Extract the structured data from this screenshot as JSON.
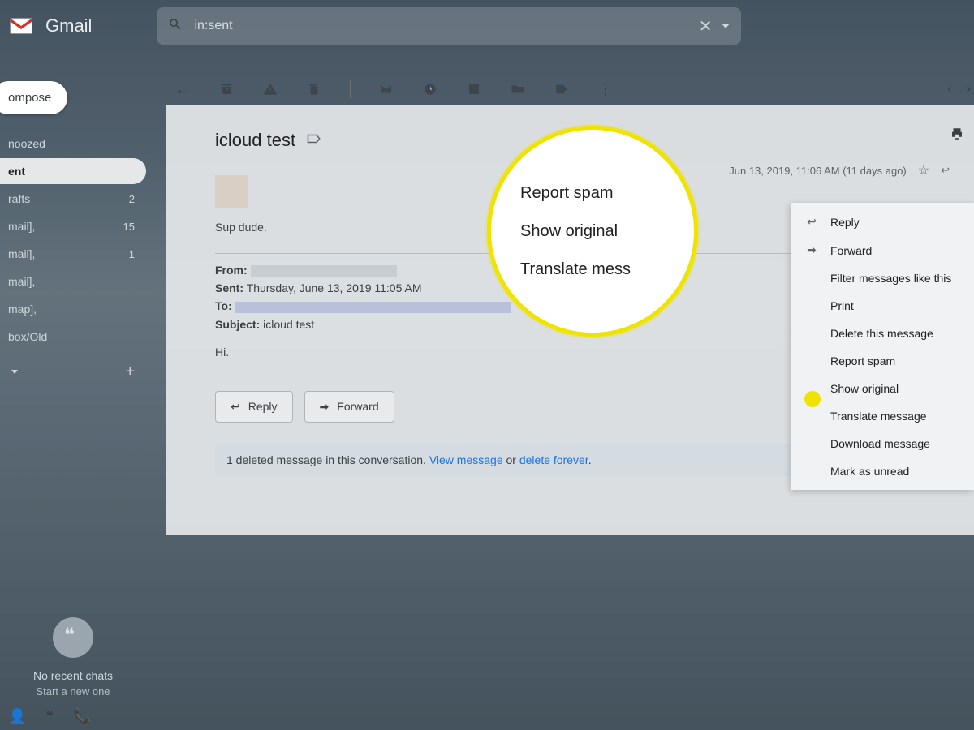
{
  "header": {
    "brand": "Gmail",
    "search_value": "in:sent"
  },
  "compose_label": "ompose",
  "nav": [
    {
      "label": "noozed",
      "count": ""
    },
    {
      "label": "ent",
      "count": ""
    },
    {
      "label": "rafts",
      "count": "2"
    },
    {
      "label": "mail],",
      "count": "15"
    },
    {
      "label": "mail],",
      "count": "1"
    },
    {
      "label": "mail],",
      "count": ""
    },
    {
      "label": "map],",
      "count": ""
    },
    {
      "label": "box/Old",
      "count": ""
    }
  ],
  "hangouts": {
    "line1": "No recent chats",
    "line2": "Start a new one"
  },
  "subject": "icloud test",
  "timestamp": "Jun 13, 2019, 11:06 AM (11 days ago)",
  "greeting": "Sup dude.",
  "headers": {
    "from_label": "From:",
    "sent_label": "Sent:",
    "sent_value": "Thursday, June 13, 2019 11:05 AM",
    "to_label": "To:",
    "subject_label": "Subject:",
    "subject_value": "icloud test"
  },
  "body_hi": "Hi.",
  "buttons": {
    "reply": "Reply",
    "forward": "Forward"
  },
  "deleted_notice": {
    "prefix": "1 deleted message in this conversation. ",
    "view": "View message",
    "mid": " or ",
    "del": "delete forever",
    "suffix": "."
  },
  "context_menu": [
    {
      "label": "Reply",
      "icon": "↩"
    },
    {
      "label": "Forward",
      "icon": "➡"
    },
    {
      "label": "Filter messages like this"
    },
    {
      "label": "Print"
    },
    {
      "label": "Delete this message"
    },
    {
      "label": "Report spam"
    },
    {
      "label": "Show original"
    },
    {
      "label": "Translate message"
    },
    {
      "label": "Download message"
    },
    {
      "label": "Mark as unread"
    }
  ],
  "callout": {
    "a": "Report spam",
    "b": "Show original",
    "c": "Translate mess"
  }
}
